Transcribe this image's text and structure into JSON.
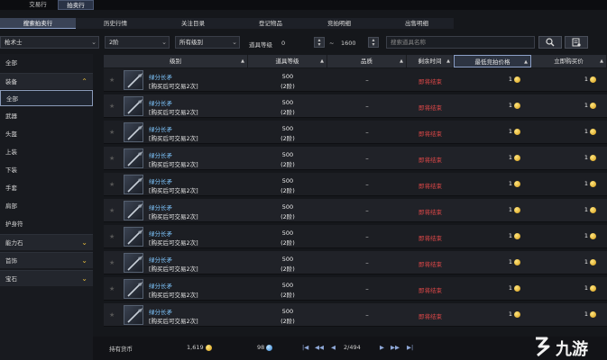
{
  "top_tabs": [
    "交易行",
    "拍卖行"
  ],
  "sub_tabs": [
    "搜索拍卖行",
    "历史行情",
    "关注目录",
    "登记物品",
    "竞拍明细",
    "出售明细"
  ],
  "filters": {
    "class": "枪术士",
    "tier": "2阶",
    "grade": "所有级别",
    "item_level_label": "道具等级",
    "item_level_min": "0",
    "item_level_sep": "~",
    "item_level_max": "1600",
    "search_placeholder": "搜索道具名称"
  },
  "sidebar": {
    "all": "全部",
    "equipment": "装备",
    "sub_items": [
      "全部",
      "武器",
      "头盔",
      "上装",
      "下装",
      "手套",
      "肩部",
      "护身符"
    ],
    "categories": [
      "能力石",
      "首饰",
      "宝石"
    ]
  },
  "columns": [
    "级别",
    "道具等级",
    "品质",
    "剩余时间",
    "最低竞拍价格",
    "立即购买价"
  ],
  "sort_glyph": "▲",
  "rows": [
    {
      "name": "绿分长矛",
      "note": "[购买后可交易2次]",
      "level": "500",
      "tier": "(2阶)",
      "quality": "–",
      "time": "即将结束",
      "bid": "1",
      "buyout": "1"
    },
    {
      "name": "绿分长矛",
      "note": "[购买后可交易2次]",
      "level": "500",
      "tier": "(2阶)",
      "quality": "–",
      "time": "即将结束",
      "bid": "1",
      "buyout": "1"
    },
    {
      "name": "绿分长矛",
      "note": "[购买后可交易2次]",
      "level": "500",
      "tier": "(2阶)",
      "quality": "–",
      "time": "即将结束",
      "bid": "1",
      "buyout": "1"
    },
    {
      "name": "绿分长矛",
      "note": "[购买后可交易2次]",
      "level": "500",
      "tier": "(2阶)",
      "quality": "–",
      "time": "即将结束",
      "bid": "1",
      "buyout": "1"
    },
    {
      "name": "绿分长矛",
      "note": "[购买后可交易2次]",
      "level": "500",
      "tier": "(2阶)",
      "quality": "–",
      "time": "即将结束",
      "bid": "1",
      "buyout": "1"
    },
    {
      "name": "绿分长矛",
      "note": "[购买后可交易2次]",
      "level": "500",
      "tier": "(2阶)",
      "quality": "–",
      "time": "即将结束",
      "bid": "1",
      "buyout": "1"
    },
    {
      "name": "绿分长矛",
      "note": "[购买后可交易2次]",
      "level": "500",
      "tier": "(2阶)",
      "quality": "–",
      "time": "即将结束",
      "bid": "1",
      "buyout": "1"
    },
    {
      "name": "绿分长矛",
      "note": "[购买后可交易2次]",
      "level": "500",
      "tier": "(2阶)",
      "quality": "–",
      "time": "即将结束",
      "bid": "1",
      "buyout": "1"
    },
    {
      "name": "绿分长矛",
      "note": "[购买后可交易2次]",
      "level": "500",
      "tier": "(2阶)",
      "quality": "–",
      "time": "即将结束",
      "bid": "1",
      "buyout": "1"
    },
    {
      "name": "绿分长矛",
      "note": "[购买后可交易2次]",
      "level": "500",
      "tier": "(2阶)",
      "quality": "–",
      "time": "即将结束",
      "bid": "1",
      "buyout": "1"
    }
  ],
  "footer": {
    "currency_label": "持有货币",
    "gold": "1,619",
    "crystal": "98",
    "page": "2/494",
    "first_glyph": "|◀",
    "prev10_glyph": "◀◀",
    "prev_glyph": "◀",
    "next_glyph": "▶",
    "next10_glyph": "▶▶",
    "last_glyph": "▶|"
  },
  "watermark": "九游",
  "icons": {
    "search": "search-icon",
    "settings": "filter-settings-icon",
    "favorite": "star-icon",
    "weapon": "spear-icon",
    "gold": "gold-coin-icon",
    "crystal": "crystal-icon"
  },
  "colors": {
    "accent": "#8ca0c8",
    "time_warning": "#e04848",
    "item_name": "#7fc7ff",
    "category_arrow": "#e2b83c",
    "gold": "#d49a15"
  }
}
